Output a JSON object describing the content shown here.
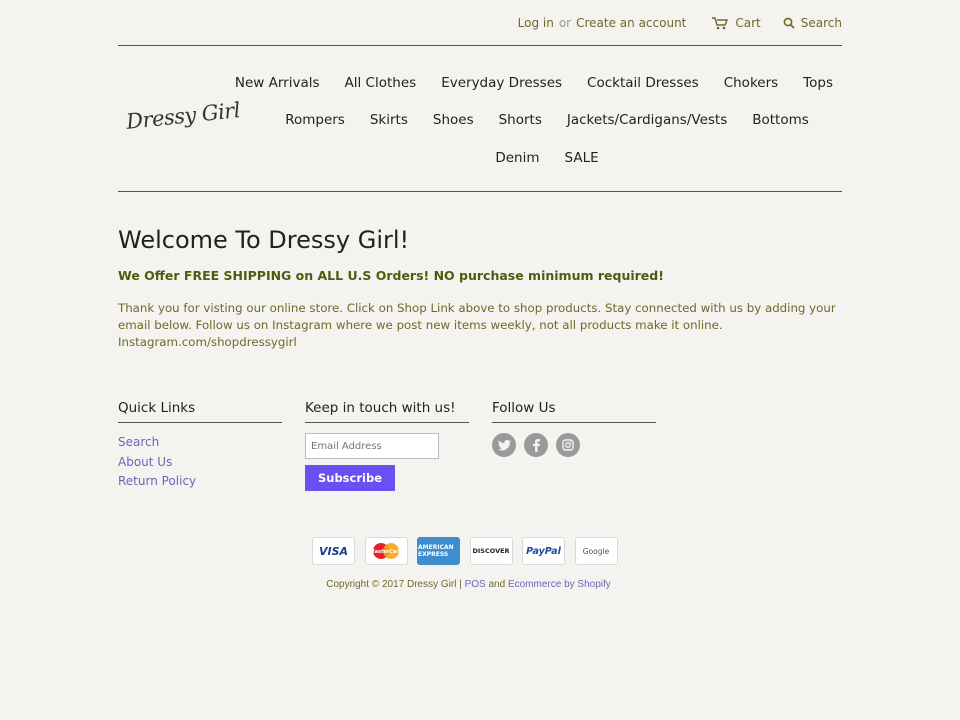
{
  "topbar": {
    "login": "Log in",
    "or": "or",
    "create": "Create an account",
    "cart": "Cart",
    "search": "Search"
  },
  "logo": {
    "text": "Dressy Girl"
  },
  "nav": {
    "row1": [
      "New Arrivals",
      "All Clothes",
      "Everyday Dresses",
      "Cocktail Dresses",
      "Chokers",
      "Tops"
    ],
    "row2": [
      "Rompers",
      "Skirts",
      "Shoes",
      "Shorts",
      "Jackets/Cardigans/Vests",
      "Bottoms"
    ],
    "row3": [
      "Denim",
      "SALE"
    ]
  },
  "main": {
    "title": "Welcome To Dressy Girl!",
    "shipping": "We Offer FREE SHIPPING on ALL U.S Orders! NO purchase minimum required!",
    "intro": "Thank you for visting our online store. Click on Shop Link above to shop products. Stay connected with us by adding your email below. Follow us on Instagram where we post new items weekly, not all products make it online. Instagram.com/shopdressygirl"
  },
  "footer": {
    "quick_links": {
      "title": "Quick Links",
      "items": [
        "Search",
        "About Us",
        "Return Policy"
      ]
    },
    "newsletter": {
      "title": "Keep in touch with us!",
      "placeholder": "Email Address",
      "button": "Subscribe"
    },
    "follow": {
      "title": "Follow Us",
      "icons": [
        "twitter-icon",
        "facebook-icon",
        "instagram-icon"
      ]
    },
    "payments": [
      "VISA",
      "MasterCard",
      "AMERICAN EXPRESS",
      "DISCOVER",
      "PayPal",
      "Google"
    ],
    "copyright": {
      "prefix": "Copyright © 2017 Dressy Girl |",
      "pos": "POS",
      "and": "and",
      "ecommerce": "Ecommerce by Shopify"
    }
  },
  "colors": {
    "accent": "#6a4ff3",
    "link": "#7262b7",
    "olive": "#6b6b2a",
    "background": "#f4f3ef"
  }
}
